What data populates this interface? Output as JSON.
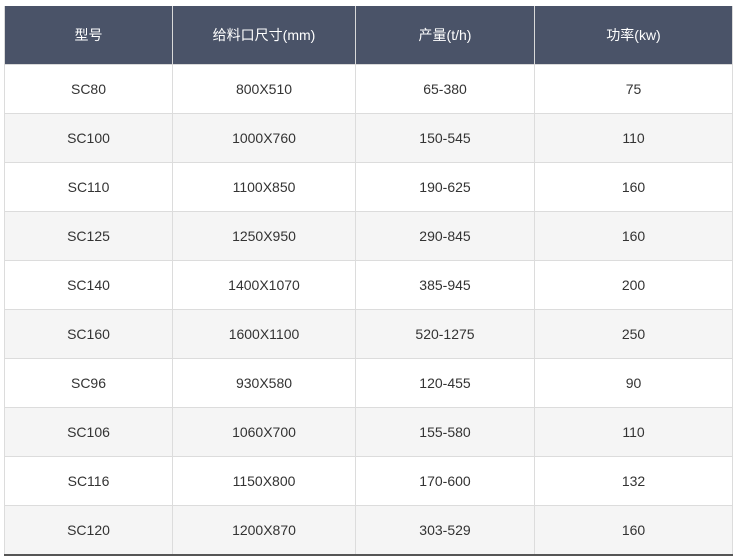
{
  "table": {
    "headers": [
      "型号",
      "给料口尺寸(mm)",
      "产量(t/h)",
      "功率(kw)"
    ],
    "rows": [
      [
        "SC80",
        "800X510",
        "65-380",
        "75"
      ],
      [
        "SC100",
        "1000X760",
        "150-545",
        "110"
      ],
      [
        "SC110",
        "1100X850",
        "190-625",
        "160"
      ],
      [
        "SC125",
        "1250X950",
        "290-845",
        "160"
      ],
      [
        "SC140",
        "1400X1070",
        "385-945",
        "200"
      ],
      [
        "SC160",
        "1600X1100",
        "520-1275",
        "250"
      ],
      [
        "SC96",
        "930X580",
        "120-455",
        "90"
      ],
      [
        "SC106",
        "1060X700",
        "155-580",
        "110"
      ],
      [
        "SC116",
        "1150X800",
        "170-600",
        "132"
      ],
      [
        "SC120",
        "1200X870",
        "303-529",
        "160"
      ]
    ]
  },
  "colors": {
    "header_bg": "#4a5368",
    "header_text": "#ffffff",
    "row_alt_bg": "#f5f5f5",
    "border": "#dcdcdc"
  }
}
